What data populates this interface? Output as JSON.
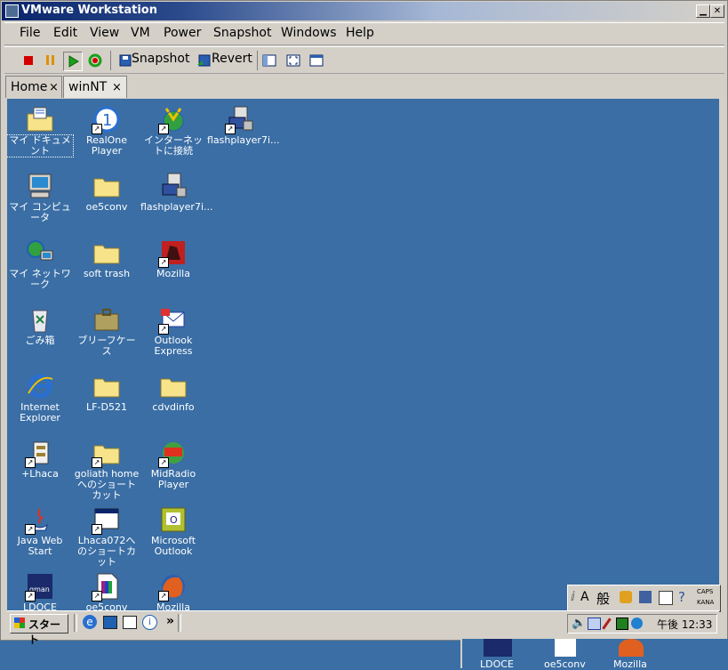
{
  "window": {
    "title": "VMware Workstation"
  },
  "menu": [
    "File",
    "Edit",
    "View",
    "VM",
    "Power",
    "Snapshot",
    "Windows",
    "Help"
  ],
  "toolbar": {
    "snapshot_label": "Snapshot",
    "revert_label": "Revert"
  },
  "tabs": [
    {
      "label": "Home",
      "close": "×"
    },
    {
      "label": "winNT",
      "close": "×"
    }
  ],
  "desktop_icons": [
    {
      "label": "マイ ドキュメント",
      "icon": "folder-documents-icon"
    },
    {
      "label": "RealOne Player",
      "icon": "realone-icon",
      "shortcut": true
    },
    {
      "label": "インターネットに接続",
      "icon": "connect-internet-icon",
      "shortcut": true
    },
    {
      "label": "flashplayer7i...",
      "icon": "installer-icon",
      "shortcut": true
    },
    {
      "label": "マイ コンピュータ",
      "icon": "computer-icon"
    },
    {
      "label": "oe5conv",
      "icon": "folder-icon"
    },
    {
      "label": "flashplayer7i...",
      "icon": "installer-icon"
    },
    {
      "label": "マイ ネットワーク",
      "icon": "network-icon"
    },
    {
      "label": "soft trash",
      "icon": "folder-icon"
    },
    {
      "label": "Mozilla",
      "icon": "mozilla-icon",
      "shortcut": true
    },
    {
      "label": "ごみ箱",
      "icon": "recycle-bin-icon"
    },
    {
      "label": "ブリーフケース",
      "icon": "briefcase-icon"
    },
    {
      "label": "Outlook Express",
      "icon": "outlook-express-icon",
      "shortcut": true
    },
    {
      "label": "Internet Explorer",
      "icon": "ie-icon"
    },
    {
      "label": "LF-D521",
      "icon": "folder-icon"
    },
    {
      "label": "cdvdinfo",
      "icon": "folder-icon"
    },
    {
      "label": "+Lhaca",
      "icon": "lhaca-icon",
      "shortcut": true
    },
    {
      "label": "goliath home へのショートカット",
      "icon": "folder-icon",
      "shortcut": true
    },
    {
      "label": "MidRadio Player",
      "icon": "midradio-icon",
      "shortcut": true
    },
    {
      "label": "Java Web Start",
      "icon": "java-icon",
      "shortcut": true
    },
    {
      "label": "Lhaca072へのショートカット",
      "icon": "window-icon",
      "shortcut": true
    },
    {
      "label": "Microsoft Outlook",
      "icon": "outlook-icon"
    },
    {
      "label": "LDOCE",
      "icon": "ldoce-icon",
      "shortcut": true
    },
    {
      "label": "oe5conv",
      "icon": "winrar-icon",
      "shortcut": true
    },
    {
      "label": "Mozilla",
      "icon": "firefox-icon",
      "shortcut": true
    }
  ],
  "taskbar": {
    "start_label": "スタート",
    "clock": "午後 12:33",
    "more": "»"
  },
  "ime": {
    "label_kanji": "般",
    "caps": "CAPS",
    "kana": "KANA"
  },
  "peek_icons": [
    "LDOCE",
    "oe5conv",
    "Mozilla"
  ],
  "colors": {
    "desktop": "#3a6ea5",
    "chrome": "#d4d0c8",
    "title": "#0a246a",
    "folder": "#f7e48a"
  }
}
